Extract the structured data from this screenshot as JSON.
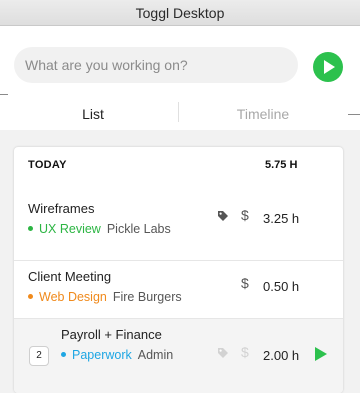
{
  "window": {
    "title": "Toggl Desktop"
  },
  "timer": {
    "placeholder": "What are you working on?",
    "start_icon": "play-icon"
  },
  "tabs": [
    {
      "label": "List",
      "active": true
    },
    {
      "label": "Timeline",
      "active": false
    }
  ],
  "day": {
    "label": "TODAY",
    "total": "5.75 H",
    "entries": [
      {
        "description": "Wireframes",
        "project": "UX Review",
        "project_color": "#2cb543",
        "client": "Pickle Labs",
        "tagged": true,
        "billable": true,
        "duration": "3.25 h"
      },
      {
        "description": "Client Meeting",
        "project": "Web Design",
        "project_color": "#f08a1c",
        "client": "Fire Burgers",
        "tagged": false,
        "billable": true,
        "duration": "0.50 h"
      },
      {
        "group_count": "2",
        "description": "Payroll + Finance",
        "project": "Paperwork",
        "project_color": "#1ea6e3",
        "client": "Admin",
        "tagged": false,
        "billable": false,
        "duration": "2.00 h"
      }
    ]
  },
  "colors": {
    "accent": "#2cc14d",
    "tag_active": "#555555",
    "tag_inactive": "#d2d2d2"
  }
}
